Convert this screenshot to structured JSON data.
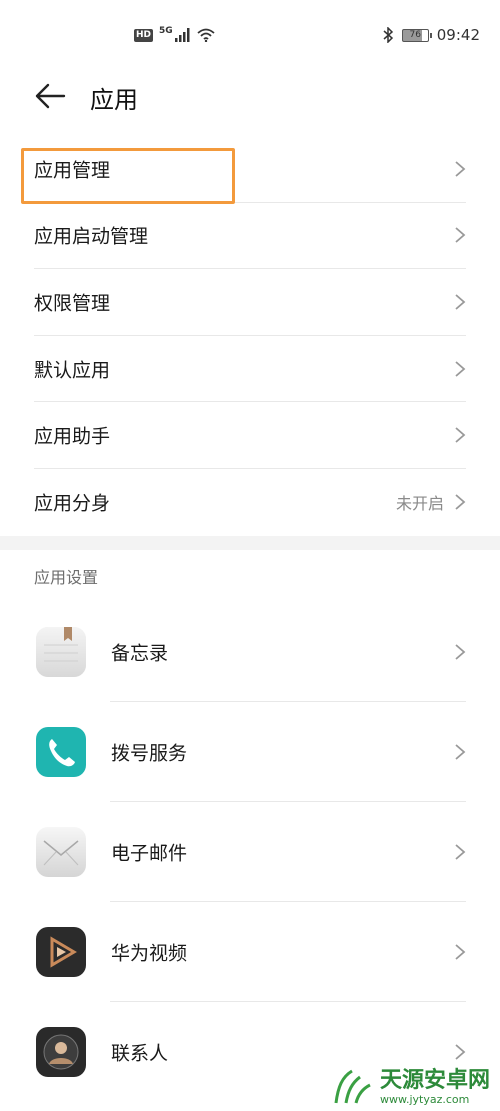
{
  "status_bar": {
    "hd": "HD",
    "network": "5G",
    "battery": "76",
    "time": "09:42"
  },
  "header": {
    "title": "应用"
  },
  "menu": [
    {
      "label": "应用管理",
      "value": ""
    },
    {
      "label": "应用启动管理",
      "value": ""
    },
    {
      "label": "权限管理",
      "value": ""
    },
    {
      "label": "默认应用",
      "value": ""
    },
    {
      "label": "应用助手",
      "value": ""
    },
    {
      "label": "应用分身",
      "value": "未开启"
    }
  ],
  "section_title": "应用设置",
  "apps": [
    {
      "label": "备忘录",
      "icon": "notepad-icon"
    },
    {
      "label": "拨号服务",
      "icon": "phone-icon"
    },
    {
      "label": "电子邮件",
      "icon": "mail-icon"
    },
    {
      "label": "华为视频",
      "icon": "video-play-icon"
    },
    {
      "label": "联系人",
      "icon": "contacts-icon"
    }
  ],
  "watermark": {
    "main": "天源安卓网",
    "sub": "www.jytyaz.com"
  },
  "colors": {
    "highlight": "#f39a3c",
    "teal": "#1fb5b0",
    "watermark": "#2d8a3a"
  }
}
